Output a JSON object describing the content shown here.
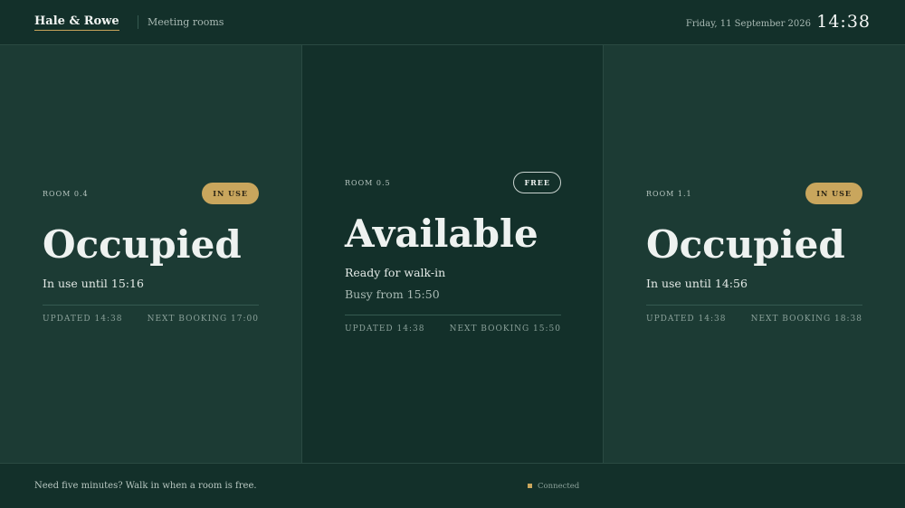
{
  "header": {
    "brand": "Hale & Rowe",
    "section": "Meeting rooms",
    "date": "Friday, 11 September 2026",
    "time": "14:38"
  },
  "rooms": [
    {
      "code": "ROOM 0.4",
      "badge": "IN USE",
      "status": "Occupied",
      "line1": "In use until 15:16",
      "line2": "",
      "updated": "UPDATED 14:38",
      "next": "NEXT BOOKING 17:00"
    },
    {
      "code": "ROOM 0.5",
      "badge": "FREE",
      "status": "Available",
      "line1": "Ready for walk-in",
      "line2": "Busy from 15:50",
      "updated": "UPDATED 14:38",
      "next": "NEXT BOOKING 15:50"
    },
    {
      "code": "ROOM 1.1",
      "badge": "IN USE",
      "status": "Occupied",
      "line1": "In use until 14:56",
      "line2": "",
      "updated": "UPDATED 14:38",
      "next": "NEXT BOOKING 18:38"
    }
  ],
  "footer": {
    "tagline": "Need five minutes? Walk in when a room is free.",
    "connection": "Connected"
  },
  "colors": {
    "background": "#13302a",
    "occupied_panel": "#1c3b34",
    "accent_gold": "#c9a65d"
  }
}
